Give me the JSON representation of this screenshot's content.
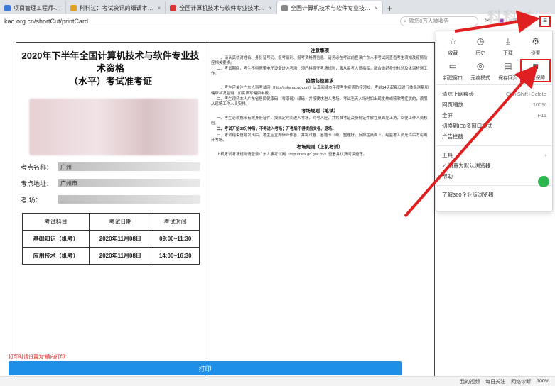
{
  "tabs": [
    {
      "label": "项目管理工程师-…",
      "active": false
    },
    {
      "label": "科科过：考试资讯的细调本…",
      "active": false
    },
    {
      "label": "全国计算机技术与软件专业技术…",
      "active": false
    },
    {
      "label": "全国计算机技术与软件专业技…",
      "active": true
    }
  ],
  "address": {
    "url": "kao.org.cn/shortCut/printCard",
    "search_placeholder": "输您0万人被收告"
  },
  "watermark": "科科过",
  "card": {
    "title_line1": "2020年下半年全国计算机技术与软件专业技术资格",
    "title_line2": "（水平）考试准考证",
    "site_label": "考点名称：",
    "site_value": "广州",
    "addr_label": "考点地址：",
    "addr_value": "广州市",
    "room_label": "考  场：",
    "room_value": "",
    "table_headers": [
      "考试科目",
      "考试日期",
      "考试时间"
    ],
    "table_rows": [
      [
        "基础知识（纸考）",
        "2020年11月08日",
        "09:00~11:30"
      ],
      [
        "应用技术（纸考）",
        "2020年11月08日",
        "14:00~16:30"
      ]
    ]
  },
  "notice": {
    "h1": "注意事项",
    "p1": "一、请认真核对姓名、身份证号码、报考级别、报考资格等信息，请务必在考试前登录广东人事考试网查看考生须知及疫情防控相关要求。",
    "p2": "二、考试期间，考生不得携带电子设备进入考场，须严格遵守考场规则，服从监考人员指挥，配合做好身份核验及体温检测工作。",
    "h2": "疫情防控要求",
    "p3": "一、考生应关注广东人事考试网（http://rsks.gd.gov.cn/）认真阅读本年度考生疫情防控须知，考前14天起每日进行体温测量和健康状况监测，如实填写健康申报。",
    "p4": "二、考生须持本人广东省居民健康码（粤康码）绿码，并按要求进入考场。考试当天入场时如出现发热或咳嗽等症状的，须服从现场工作人员安排。",
    "h3": "考场规则（笔试）",
    "p5": "一、考生必须携带有效身份证件，按规定时间进入考场，对号入座，并将准考证及身份证件放在桌面左上角，以便工作人员核验。",
    "p6": "二、考试开始30分钟后，不得进入考场；开考后不得提前交卷、退场。",
    "p7": "三、考试结束信号发出后，考生应立即停止作答，并将试卷、答题卡（纸）整理好，反扣在桌面上，经监考人员允许后方可离开考场。",
    "h4": "考场规则（上机考试）",
    "p8": "上机考试考场规则请登录广东人事考试网（http://rsks.gd.gov.cn/）查看并认真阅读遵守。"
  },
  "print": {
    "note": "打印时请设置为“横向打印”",
    "button": "打印"
  },
  "menu": {
    "row1": [
      {
        "label": "收藏",
        "icon": "star-icon",
        "glyph": "☆"
      },
      {
        "label": "历史",
        "icon": "clock-icon",
        "glyph": "◷"
      },
      {
        "label": "下载",
        "icon": "download-icon",
        "glyph": "⤓"
      },
      {
        "label": "设置",
        "icon": "gear-icon",
        "glyph": "⚙"
      }
    ],
    "row2": [
      {
        "label": "新建窗口",
        "icon": "window-icon",
        "glyph": "▭"
      },
      {
        "label": "无痕模式",
        "icon": "incognito-icon",
        "glyph": "◎"
      },
      {
        "label": "保存网页",
        "icon": "save-icon",
        "glyph": "▤"
      },
      {
        "label": "网页保障",
        "icon": "camera-icon",
        "glyph": "◙"
      }
    ],
    "items": [
      {
        "label": "清除上网痕迹",
        "key": "Ctrl+Shift+Delete",
        "chev": ""
      },
      {
        "label": "网页缩放",
        "key": "100%",
        "chev": ""
      },
      {
        "label": "全屏",
        "key": "F11",
        "chev": ""
      },
      {
        "label": "切换到IE8多窗口模式",
        "key": "",
        "chev": ""
      },
      {
        "label": "广告拦截",
        "key": "",
        "chev": ""
      },
      {
        "label": "工具",
        "key": "",
        "chev": "›"
      },
      {
        "label": "✓ 设置为默认浏览器",
        "key": "",
        "chev": ""
      },
      {
        "label": "帮助",
        "key": "",
        "chev": "›"
      },
      {
        "label": "了解360企业版浏览器",
        "key": "",
        "chev": ""
      }
    ]
  },
  "status": {
    "item1": "我的视频",
    "item2": "每日关注",
    "item3": "网络诊断",
    "zoom": "100%"
  },
  "colors": {
    "accent_red": "#e02020",
    "print_blue": "#1e8fe8"
  }
}
